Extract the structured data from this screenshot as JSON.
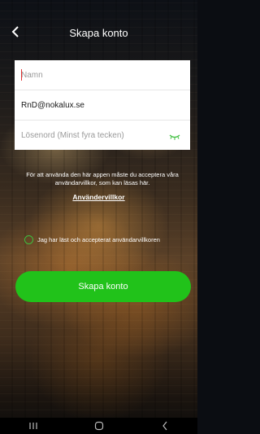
{
  "header": {
    "title": "Skapa konto",
    "back_icon": "chevron-left-icon"
  },
  "form": {
    "name": {
      "value": "",
      "placeholder": "Namn"
    },
    "email": {
      "value": "RnD@nokalux.se",
      "placeholder": ""
    },
    "password": {
      "value": "",
      "placeholder": "Lösenord (Minst fyra tecken)",
      "toggle_icon": "eye-closed-icon"
    }
  },
  "terms": {
    "text": "För att använda den här appen måste du acceptera våra användarvillkor, som kan läsas här.",
    "link_label": "Användervillkor"
  },
  "accept": {
    "label": "Jag har läst och accepterat användarvillkoren",
    "checked": false
  },
  "create_button": {
    "label": "Skapa konto"
  },
  "colors": {
    "accent": "#21c21a",
    "eye_icon": "#3fbf3f",
    "caret": "#e03030"
  },
  "nav_bar": {
    "icons": [
      "recent-apps-icon",
      "home-icon",
      "back-icon"
    ]
  }
}
